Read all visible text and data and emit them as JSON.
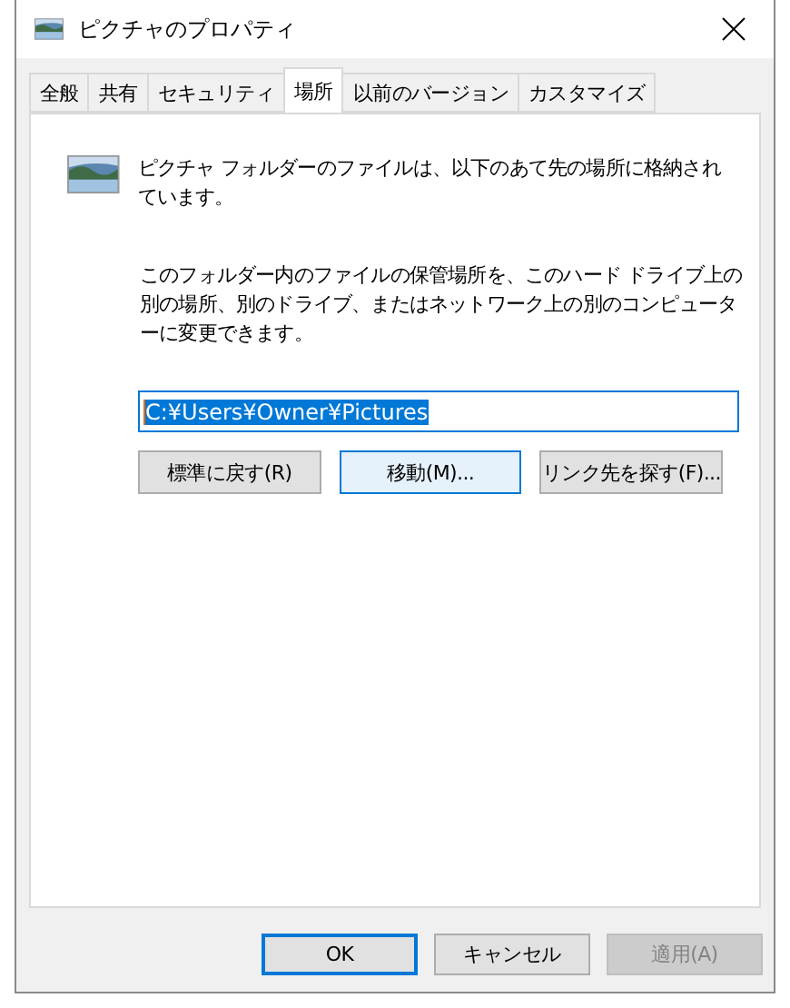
{
  "window": {
    "title": "ピクチャのプロパティ"
  },
  "tabs": [
    {
      "label": "全般",
      "selected": false
    },
    {
      "label": "共有",
      "selected": false
    },
    {
      "label": "セキュリティ",
      "selected": false
    },
    {
      "label": "場所",
      "selected": true
    },
    {
      "label": "以前のバージョン",
      "selected": false
    },
    {
      "label": "カスタマイズ",
      "selected": false
    }
  ],
  "intro": "ピクチャ フォルダーのファイルは、以下のあて先の場所に格納されています。",
  "description": "このフォルダー内のファイルの保管場所を、このハード ドライブ上の別の場所、別のドライブ、またはネットワーク上の別のコンピューターに変更できます。",
  "path_field": {
    "value": "C:¥Users¥Owner¥Pictures",
    "text_selected": true
  },
  "location_buttons": [
    {
      "label": "標準に戻す(R)",
      "focused": false
    },
    {
      "label": "移動(M)...",
      "focused": true
    },
    {
      "label": "リンク先を探す(F)...",
      "focused": false
    }
  ],
  "dialog_buttons": [
    {
      "label": "OK",
      "default": true,
      "disabled": false
    },
    {
      "label": "キャンセル",
      "default": false,
      "disabled": false
    },
    {
      "label": "適用(A)",
      "default": false,
      "disabled": true
    }
  ]
}
